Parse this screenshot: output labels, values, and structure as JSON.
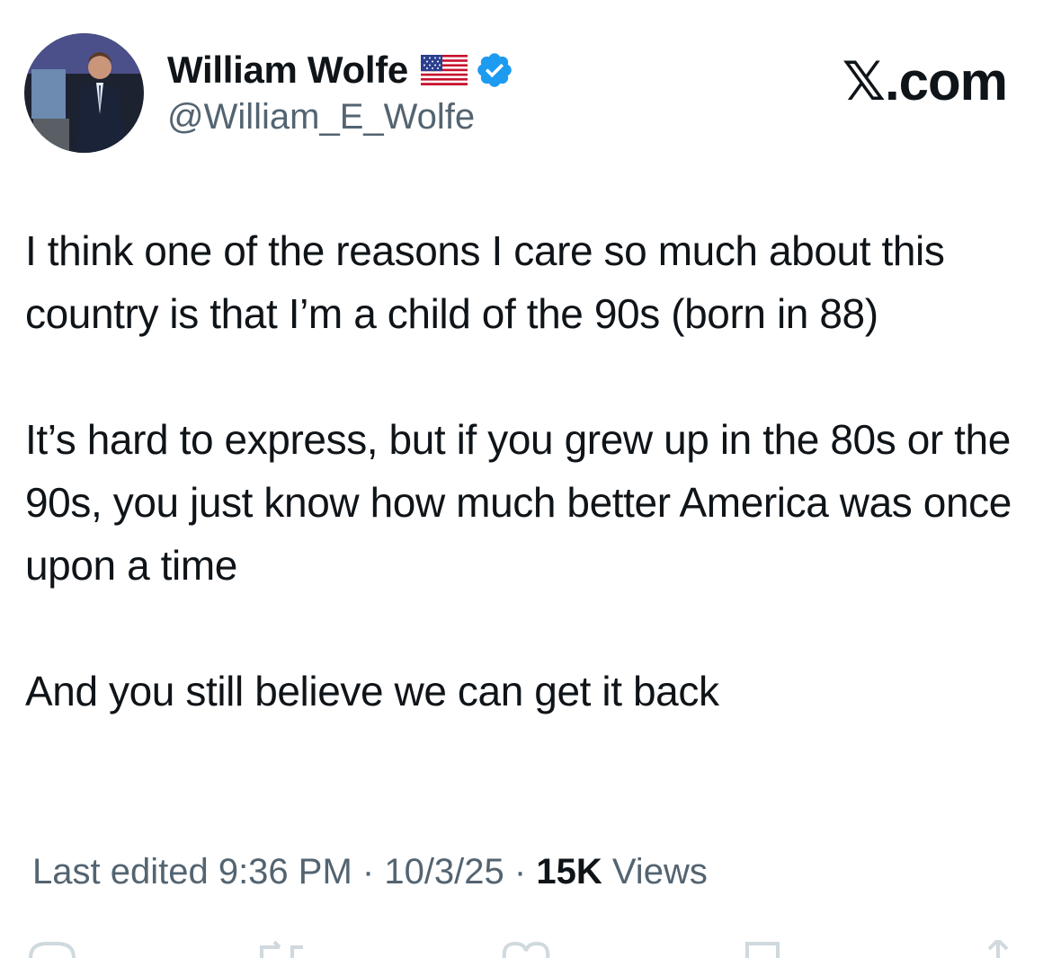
{
  "author": {
    "display_name": "William Wolfe",
    "flag_emoji": "us-flag-icon",
    "verified": true,
    "verified_color": "#1d9bf0",
    "handle": "@William_E_Wolfe"
  },
  "brand": "𝕏.com",
  "tweet": {
    "paragraphs": [
      "I think one of the reasons I care so much about this country is that I’m a child of the 90s (born in 88)",
      "It’s hard to express, but if you grew up in the 80s or the 90s, you just know how much better America was once upon a time",
      "And you still believe we can get it back"
    ]
  },
  "meta": {
    "edited_label": "Last edited 9:36 PM",
    "sep1": " · ",
    "date": "10/3/25",
    "sep2": "  · ",
    "views_count": "15K",
    "views_label": " Views"
  },
  "actions": {
    "icons": [
      "reply-icon",
      "repost-icon",
      "like-icon",
      "bookmark-icon",
      "share-icon"
    ]
  },
  "colors": {
    "text": "#0f1419",
    "secondary": "#536471",
    "verified": "#1d9bf0"
  }
}
